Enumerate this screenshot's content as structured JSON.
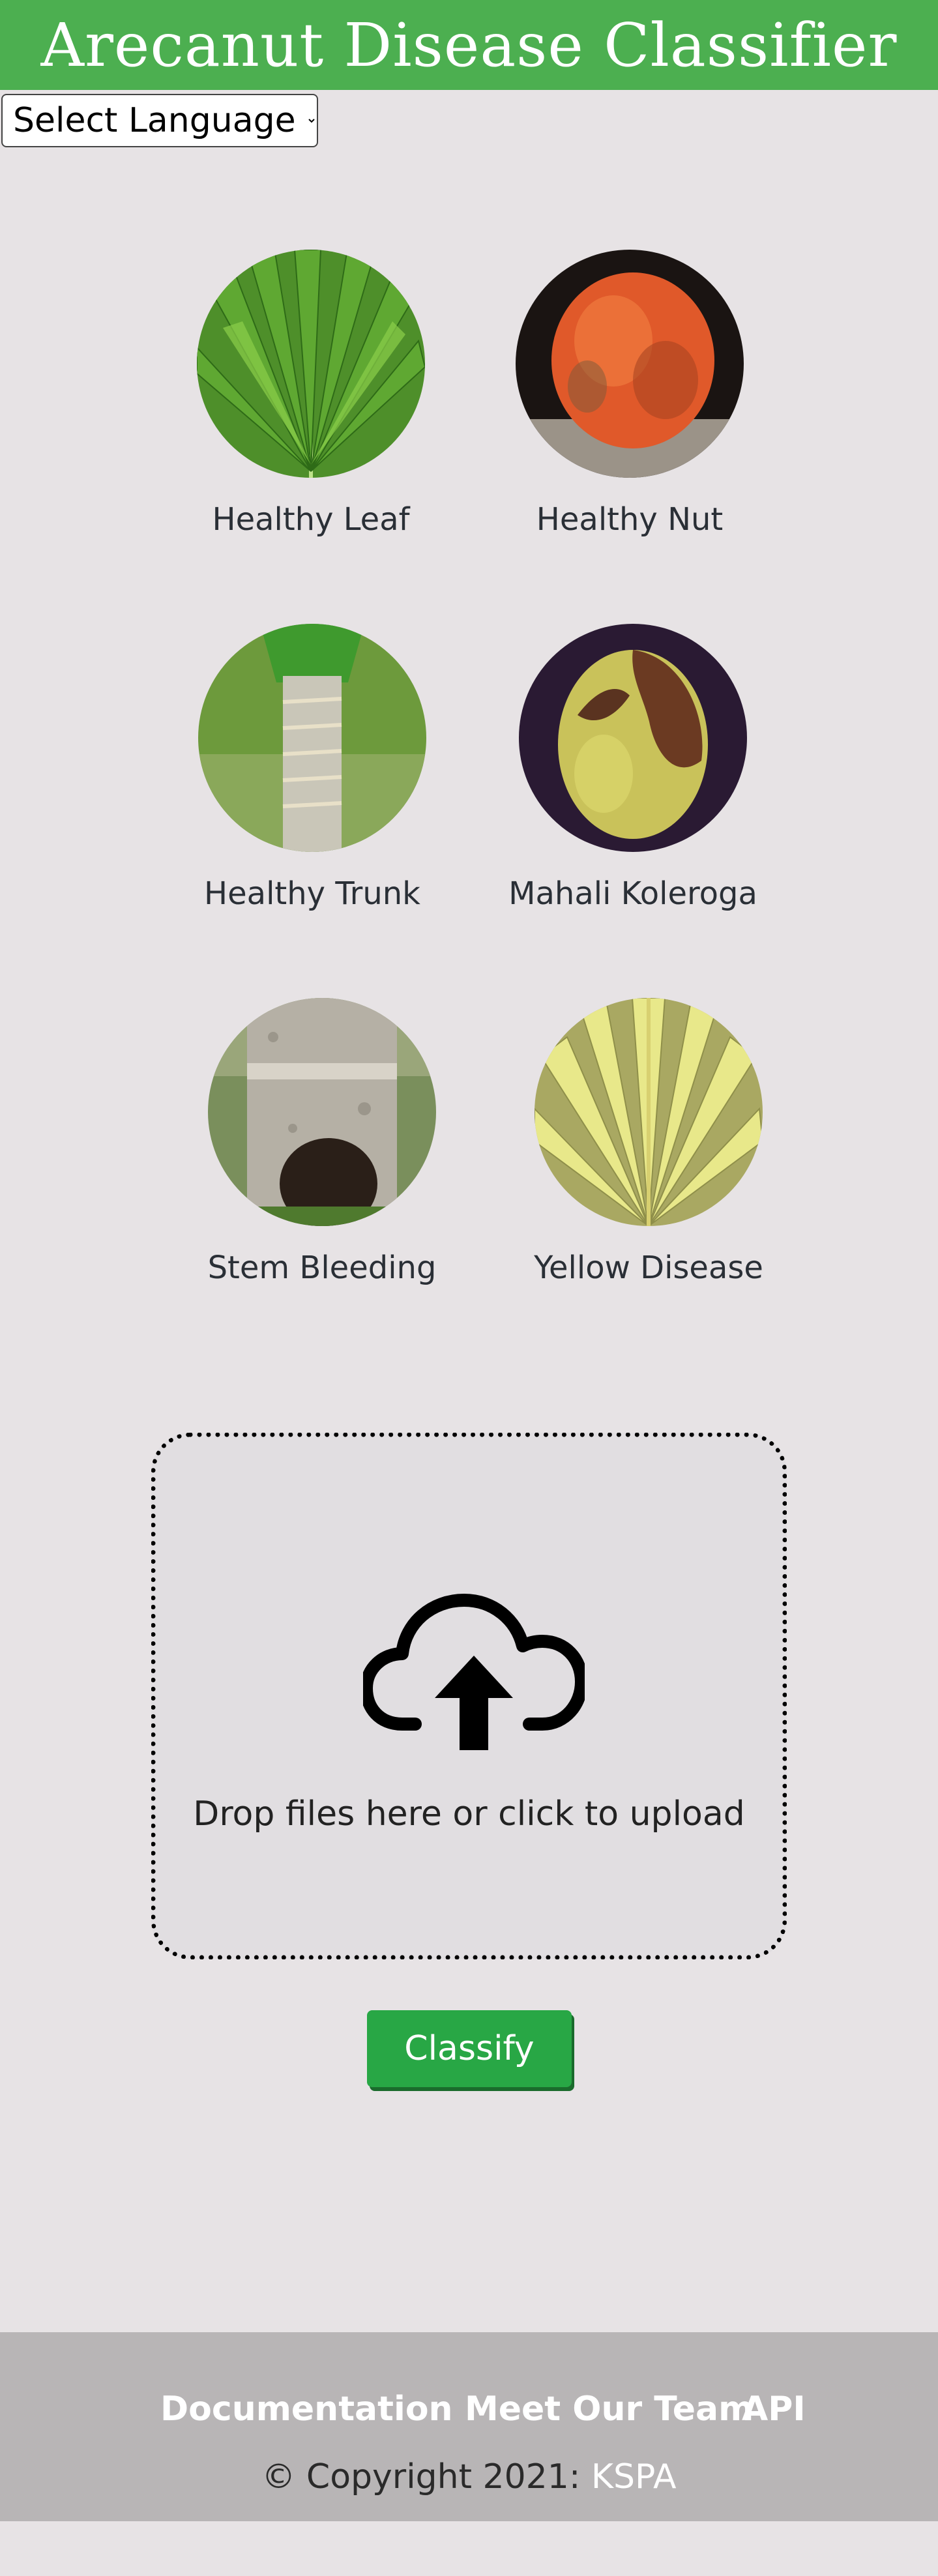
{
  "header": {
    "title": "Arecanut Disease Classifier"
  },
  "language_select": {
    "selected": "Select Language",
    "options": [
      "Select Language"
    ]
  },
  "gallery": [
    {
      "label": "Healthy Leaf",
      "icon": "healthy-leaf-image"
    },
    {
      "label": "Healthy Nut",
      "icon": "healthy-nut-image"
    },
    {
      "label": "Healthy Trunk",
      "icon": "healthy-trunk-image"
    },
    {
      "label": "Mahali Koleroga",
      "icon": "mahali-koleroga-image"
    },
    {
      "label": "Stem Bleeding",
      "icon": "stem-bleeding-image"
    },
    {
      "label": "Yellow Disease",
      "icon": "yellow-disease-image"
    }
  ],
  "upload": {
    "icon": "cloud-upload-icon",
    "text": "Drop files here or click to upload"
  },
  "classify_button": {
    "label": "Classify"
  },
  "footer": {
    "links": [
      "Documentation",
      "Meet Our Team",
      "API"
    ],
    "copyright_prefix": "© Copyright 2021: ",
    "copyright_brand": "KSPA"
  },
  "colors": {
    "header_bg": "#4caf50",
    "page_bg": "#e7e3e5",
    "button_bg": "#28a745",
    "footer_bg": "#b8b5b6"
  }
}
